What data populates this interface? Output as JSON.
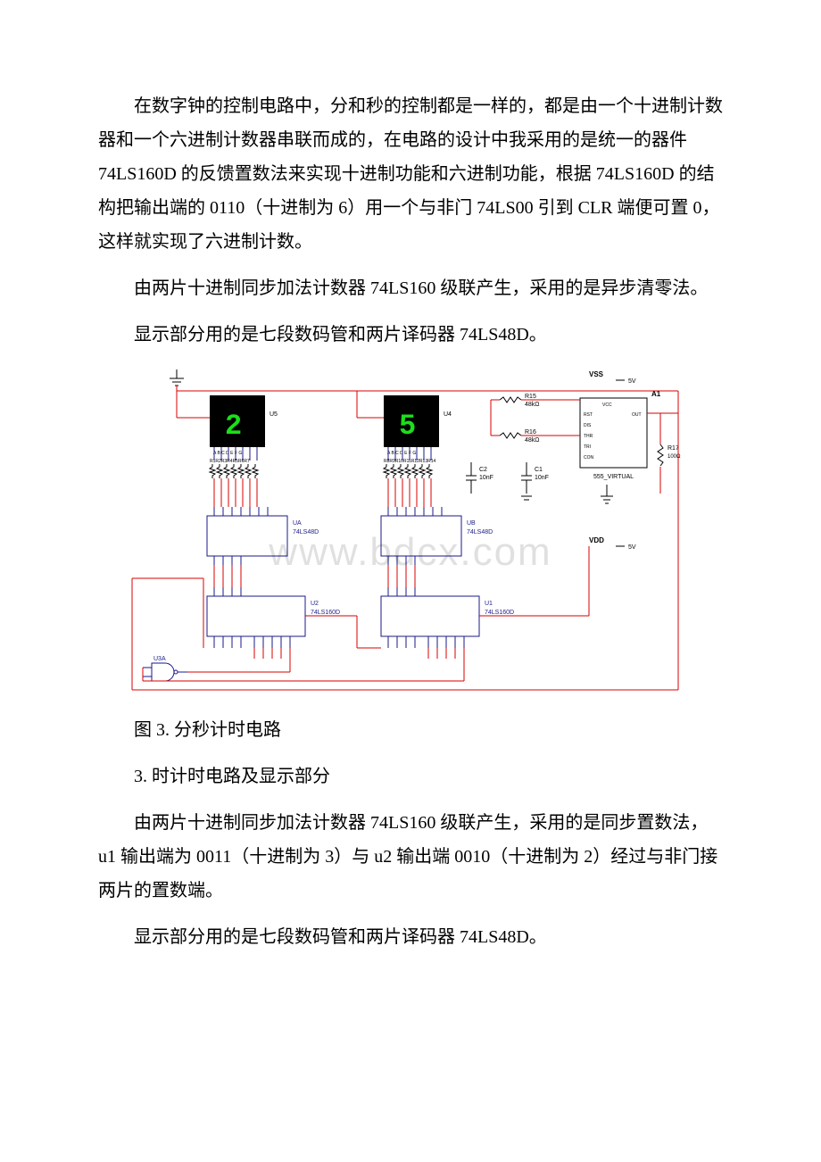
{
  "paragraph1": "在数字钟的控制电路中，分和秒的控制都是一样的，都是由一个十进制计数器和一个六进制计数器串联而成的，在电路的设计中我采用的是统一的器件 74LS160D 的反馈置数法来实现十进制功能和六进制功能，根据 74LS160D 的结构把输出端的 0110（十进制为 6）用一个与非门 74LS00 引到 CLR 端便可置 0，这样就实现了六进制计数。",
  "paragraph2": "由两片十进制同步加法计数器 74LS160 级联产生，采用的是异步清零法。",
  "paragraph3": "显示部分用的是七段数码管和两片译码器 74LS48D。",
  "figure_caption": "图 3. 分秒计时电路",
  "section_heading": "3. 时计时电路及显示部分",
  "paragraph4": "由两片十进制同步加法计数器 74LS160 级联产生，采用的是同步置数法，u1 输出端为 0011（十进制为 3）与 u2 输出端 0010（十进制为 2）经过与非门接两片的置数端。",
  "paragraph5": "显示部分用的是七段数码管和两片译码器 74LS48D。",
  "watermark": "www.bdcx.com",
  "schematic": {
    "display1": {
      "label": "U5",
      "digit": "2",
      "pins": "A B C D E F G"
    },
    "display2": {
      "label": "U4",
      "digit": "5",
      "pins": "A B C D E F G"
    },
    "decoder_a": {
      "label": "UA",
      "chip": "74LS48D"
    },
    "decoder_b": {
      "label": "UB",
      "chip": "74LS48D"
    },
    "counter1": {
      "label": "U1",
      "chip": "74LS160D"
    },
    "counter2": {
      "label": "U2",
      "chip": "74LS160D"
    },
    "gate": {
      "label": "U3A"
    },
    "r15": {
      "label": "R15",
      "value": "48kΩ"
    },
    "r16": {
      "label": "R16",
      "value": "48kΩ"
    },
    "r17": {
      "label": "R17",
      "value": "100Ω"
    },
    "c1": {
      "label": "C1",
      "value": "10nF"
    },
    "c2": {
      "label": "C2",
      "value": "10nF"
    },
    "timer": {
      "label": "A1",
      "chip": "555_VIRTUAL",
      "pins": [
        "VCC",
        "RST",
        "DIS",
        "THR",
        "TRI",
        "CON",
        "GND",
        "OUT"
      ]
    },
    "vss": {
      "label": "VSS",
      "value": "5V"
    },
    "vdd": {
      "label": "VDD",
      "value": "5V"
    },
    "res_series1": "R1R2R3R4R5R6R7",
    "res_series2": "R8R9R10R11R12R13R14"
  }
}
